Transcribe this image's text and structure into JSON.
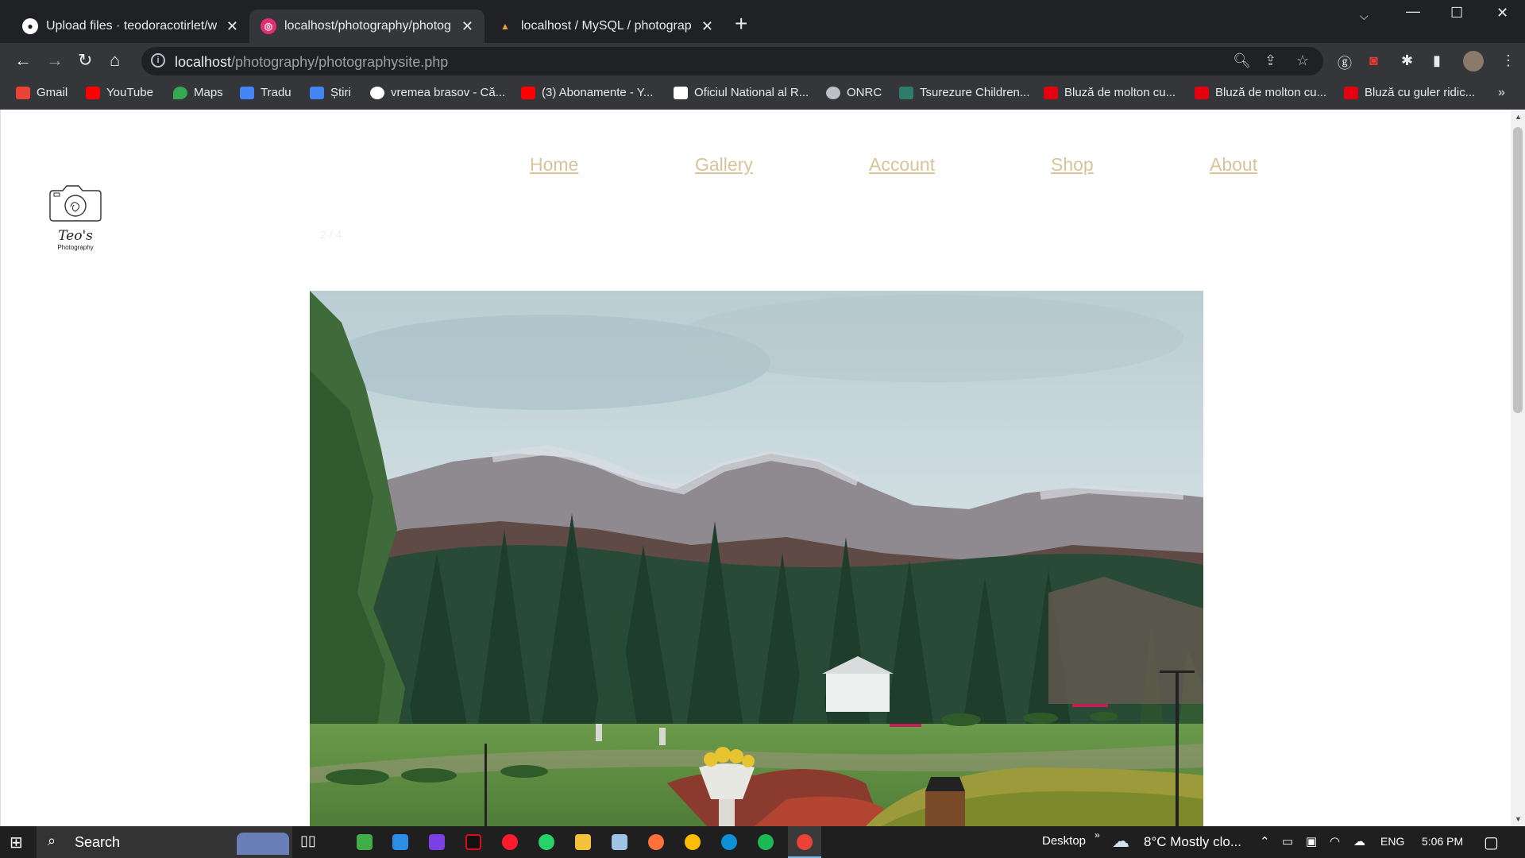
{
  "browser": {
    "tabs": [
      {
        "title": "Upload files · teodoracotirlet/wel",
        "active": false
      },
      {
        "title": "localhost/photography/photogra",
        "active": true
      },
      {
        "title": "localhost / MySQL / photography",
        "active": false
      }
    ],
    "url_host": "localhost",
    "url_path": "/photography/photographysite.php",
    "bookmarks": [
      {
        "label": "Gmail",
        "color": "#ea4335"
      },
      {
        "label": "YouTube",
        "color": "#ff0000"
      },
      {
        "label": "Maps",
        "color": "#34a853"
      },
      {
        "label": "Tradu",
        "color": "#4285f4"
      },
      {
        "label": "Știri",
        "color": "#4285f4"
      },
      {
        "label": "vremea brasov - Că...",
        "color": "#ffffff"
      },
      {
        "label": "(3) Abonamente - Y...",
        "color": "#ff0000"
      },
      {
        "label": "Oficiul National al R...",
        "color": "#ffffff"
      },
      {
        "label": "ONRC",
        "color": "#bdc1c6"
      },
      {
        "label": "Tsurezure Children...",
        "color": "#2e7d6b"
      },
      {
        "label": "Bluză de molton cu...",
        "color": "#e50010"
      },
      {
        "label": "Bluză de molton cu...",
        "color": "#e50010"
      },
      {
        "label": "Bluză cu guler ridic...",
        "color": "#e50010"
      }
    ],
    "more_bookmarks": "»"
  },
  "site": {
    "nav": {
      "home": "Home",
      "gallery": "Gallery",
      "account": "Account",
      "shop": "Shop",
      "about": "About"
    },
    "logo_name": "Teo's",
    "logo_sub": "Photography",
    "slide_counter": "2 / 4",
    "nav_color": "#d8c39a"
  },
  "taskbar": {
    "search_label": "Search",
    "desktop_label": "Desktop",
    "weather": "8°C  Mostly clo...",
    "language": "ENG",
    "time": "5:06 PM"
  }
}
